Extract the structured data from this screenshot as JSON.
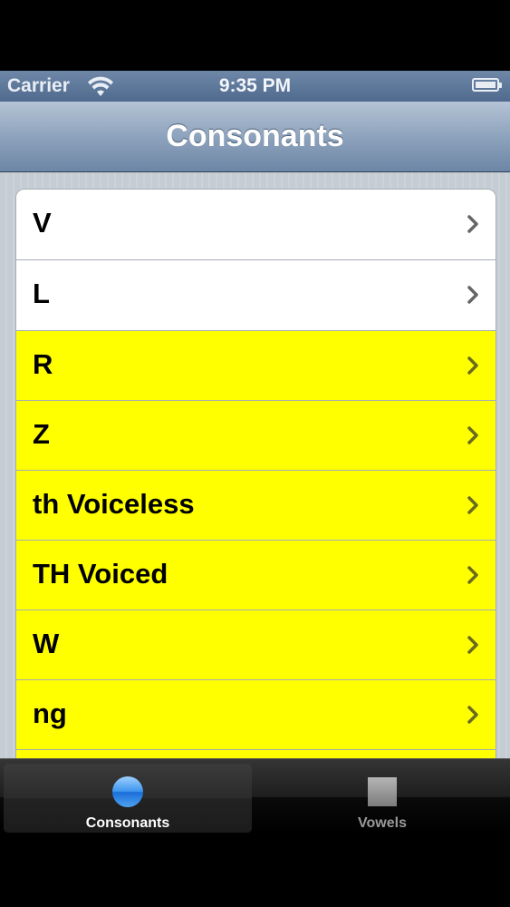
{
  "status_bar": {
    "carrier": "Carrier",
    "time": "9:35 PM"
  },
  "nav": {
    "title": "Consonants"
  },
  "rows": [
    {
      "label": "V",
      "color": "#ffffff"
    },
    {
      "label": "L",
      "color": "#ffffff"
    },
    {
      "label": "R",
      "color": "#ffff00"
    },
    {
      "label": "Z",
      "color": "#ffff00"
    },
    {
      "label": "th Voiceless",
      "color": "#ffff00"
    },
    {
      "label": "TH Voiced",
      "color": "#ffff00"
    },
    {
      "label": "W",
      "color": "#ffff00"
    },
    {
      "label": "ng",
      "color": "#ffff00"
    }
  ],
  "tabs": [
    {
      "label": "Consonants",
      "icon": "circle-icon",
      "selected": true
    },
    {
      "label": "Vowels",
      "icon": "square-icon",
      "selected": false
    }
  ],
  "colors": {
    "highlight": "#ffff00",
    "nav_bar": "#8ea3bd",
    "tab_selected_icon": "#3e96ee"
  }
}
